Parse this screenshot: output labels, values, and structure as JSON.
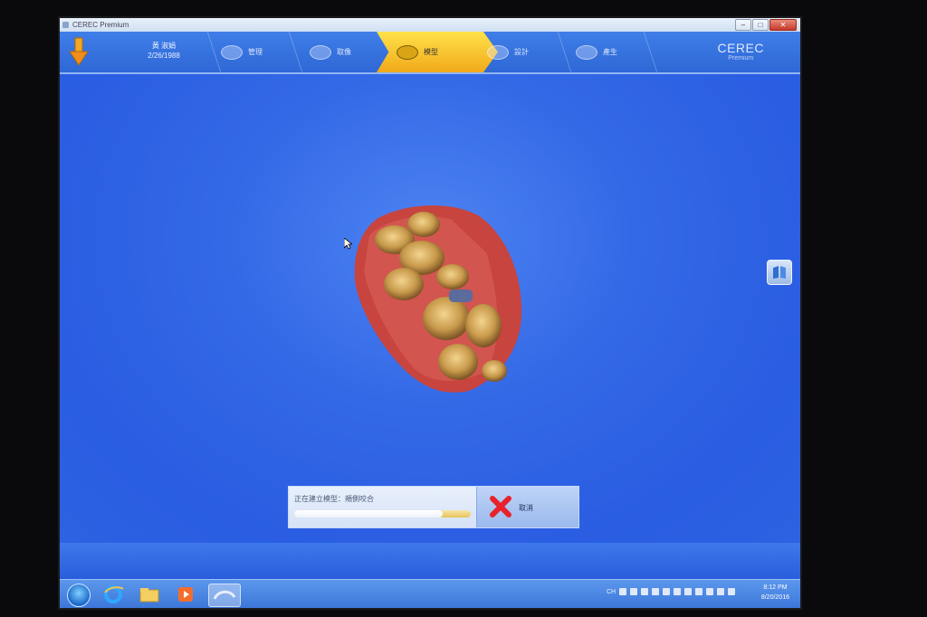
{
  "window": {
    "title": "CEREC Premium"
  },
  "patient": {
    "name": "黃 淑娟",
    "dob": "2/26/1988"
  },
  "steps": [
    {
      "label": "管理"
    },
    {
      "label": "取像"
    },
    {
      "label": "模型",
      "active": true
    },
    {
      "label": "設計"
    },
    {
      "label": "產生"
    }
  ],
  "brand": {
    "name": "CEREC",
    "edition": "Premium"
  },
  "progress": {
    "message": "正在建立模型：頰側咬合",
    "fraction": 0.84,
    "cancel_label": "取消"
  },
  "taskbar": {
    "lang": "CH",
    "time": "8:12 PM",
    "date": "8/20/2016"
  },
  "colors": {
    "background": "#2b63e6",
    "active_step": "#f7c63a",
    "cancel_x": "#e8212b"
  }
}
